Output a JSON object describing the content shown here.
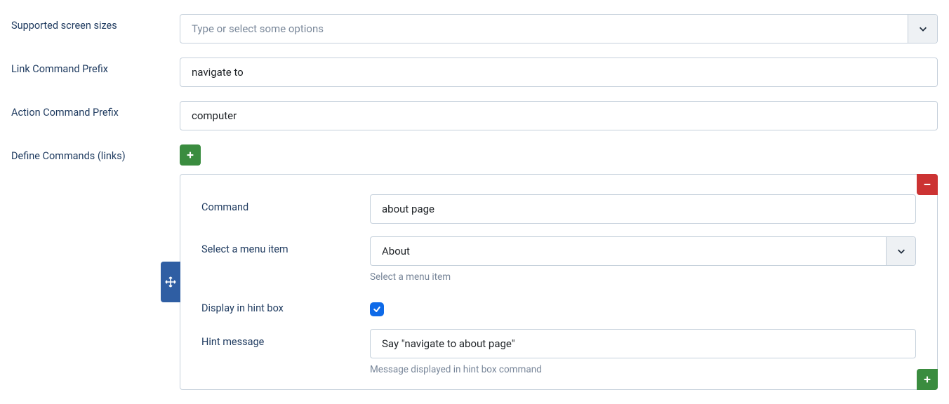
{
  "fields": {
    "screenSizes": {
      "label": "Supported screen sizes",
      "placeholder": "Type or select some options",
      "value": ""
    },
    "linkPrefix": {
      "label": "Link Command Prefix",
      "value": "navigate to"
    },
    "actionPrefix": {
      "label": "Action Command Prefix",
      "value": "computer"
    },
    "defineCommands": {
      "label": "Define Commands (links)"
    }
  },
  "command": {
    "command": {
      "label": "Command",
      "value": "about page"
    },
    "menuItem": {
      "label": "Select a menu item",
      "value": "About",
      "help": "Select a menu item"
    },
    "displayHint": {
      "label": "Display in hint box",
      "checked": true
    },
    "hintMessage": {
      "label": "Hint message",
      "value": "Say \"navigate to about page\"",
      "help": "Message displayed in hint box command"
    }
  }
}
